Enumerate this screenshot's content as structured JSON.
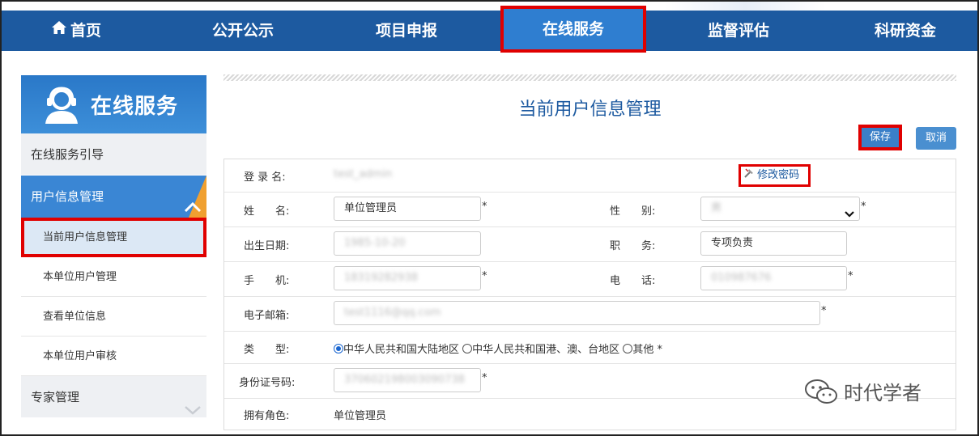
{
  "nav": {
    "items": [
      {
        "label": "首页",
        "icon": "home-icon"
      },
      {
        "label": "公开公示"
      },
      {
        "label": "项目申报"
      },
      {
        "label": "在线服务",
        "active": true
      },
      {
        "label": "监督评估"
      },
      {
        "label": "科研资金"
      }
    ]
  },
  "sidebar": {
    "banner_title": "在线服务",
    "banner_icon": "customer-service-icon",
    "guide_label": "在线服务引导",
    "group_label": "用户信息管理",
    "sub_items": [
      {
        "label": "当前用户信息管理",
        "active": true
      },
      {
        "label": "本单位用户管理"
      },
      {
        "label": "查看单位信息"
      },
      {
        "label": "本单位用户审核"
      }
    ],
    "expert_label": "专家管理"
  },
  "main": {
    "title": "当前用户信息管理",
    "save_label": "保存",
    "cancel_label": "取消"
  },
  "form": {
    "login_label": "登 录 名:",
    "login_value": "test_admin",
    "change_pwd_label": "修改密码",
    "name_label": "姓　　名:",
    "name_value": "单位管理员",
    "gender_label": "性　　别:",
    "gender_value": "男",
    "birth_label": "出生日期:",
    "birth_value": "1985-10-20",
    "position_label": "职　　务:",
    "position_value": "专项负责",
    "mobile_label": "手　　机:",
    "mobile_value": "18319282938",
    "phone_label": "电　　话:",
    "phone_value": "010987676",
    "email_label": "电子邮箱:",
    "email_value": "test1116@qq.com",
    "type_label": "类　　型:",
    "type_options": [
      "中华人民共和国大陆地区",
      "中华人民共和国港、澳、台地区",
      "其他"
    ],
    "type_selected": "中华人民共和国大陆地区",
    "id_label": "身份证号码:",
    "id_value": "370602198003090738",
    "role_label": "拥有角色:",
    "role_value": "单位管理员",
    "required_mark": "*"
  },
  "watermark": {
    "text": "时代学者",
    "icon": "wechat-icon"
  },
  "colors": {
    "nav_bg": "#1d5aa0",
    "accent": "#3a86d4",
    "highlight": "#e00000",
    "title": "#1d5aa0"
  }
}
